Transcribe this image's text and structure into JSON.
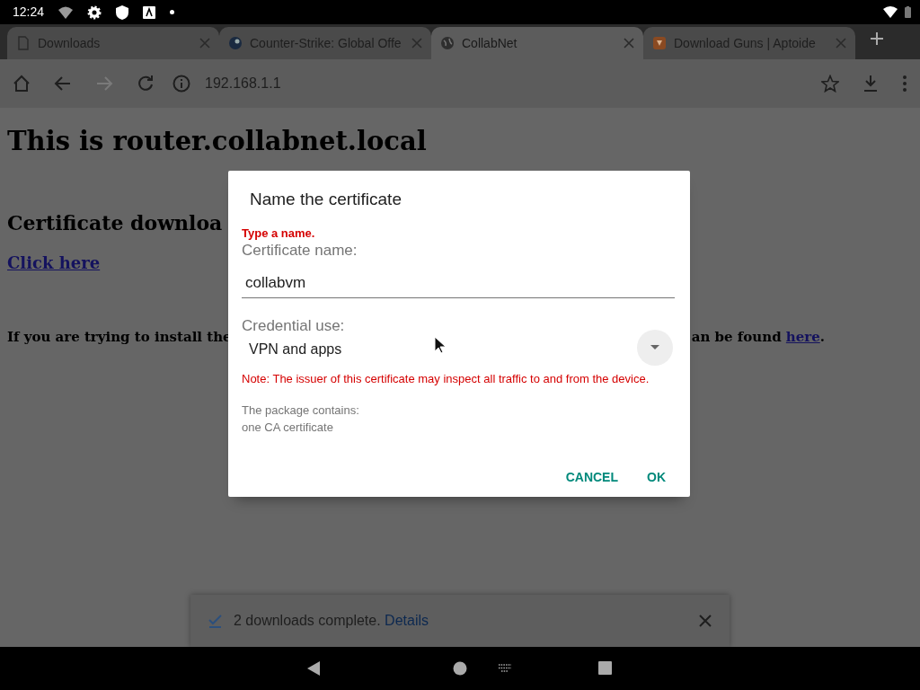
{
  "status_bar": {
    "time": "12:24"
  },
  "tabs": [
    {
      "title": "Downloads",
      "selected": false
    },
    {
      "title": "Counter-Strike: Global Offe",
      "selected": false
    },
    {
      "title": "CollabNet",
      "selected": true
    },
    {
      "title": "Download Guns | Aptoide",
      "selected": false
    }
  ],
  "toolbar": {
    "url": "192.168.1.1"
  },
  "page": {
    "heading": "This is router.collabnet.local",
    "subheading": "Certificate downloa",
    "link": "Click here",
    "paragraph_left": "If you are trying to install the",
    "paragraph_right": {
      "before": "an be found ",
      "link": "here",
      "after": "."
    }
  },
  "dialog": {
    "title": "Name the certificate",
    "error": "Type a name.",
    "name_label": "Certificate name:",
    "name_value": "collabvm",
    "use_label": "Credential use:",
    "use_value": "VPN and apps",
    "note": "Note: The issuer of this certificate may inspect all traffic to and from the device.",
    "package_label": "The package contains:",
    "package_contents": "one CA certificate",
    "buttons": [
      "CANCEL",
      "OK"
    ]
  },
  "snackbar": {
    "message": "2 downloads complete.",
    "link": "Details"
  }
}
